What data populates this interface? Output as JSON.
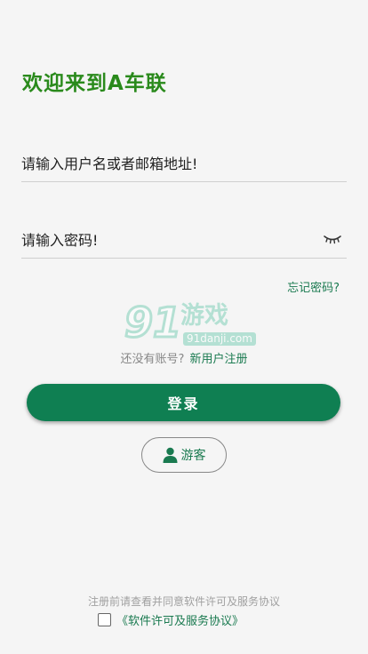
{
  "title": "欢迎来到A车联",
  "form": {
    "username_placeholder": "请输入用户名或者邮箱地址!",
    "username_value": "",
    "password_placeholder": "请输入密码!",
    "password_value": "",
    "forgot_label": "忘记密码?"
  },
  "watermark": {
    "digits": "91",
    "text": "游戏",
    "domain": "91danji.com"
  },
  "register": {
    "prompt": "还没有账号?",
    "link": "新用户注册"
  },
  "buttons": {
    "login": "登录",
    "guest": "游客"
  },
  "terms": {
    "note": "注册前请查看并同意软件许可及服务协议",
    "link": "《软件许可及服务协议》",
    "checked": false
  },
  "colors": {
    "accent": "#0f7f52",
    "title": "#2a8a1c",
    "link": "#1a7a50",
    "background": "#f5f5f5"
  },
  "icons": {
    "password_toggle": "eye-closed-icon",
    "guest": "user-icon"
  }
}
